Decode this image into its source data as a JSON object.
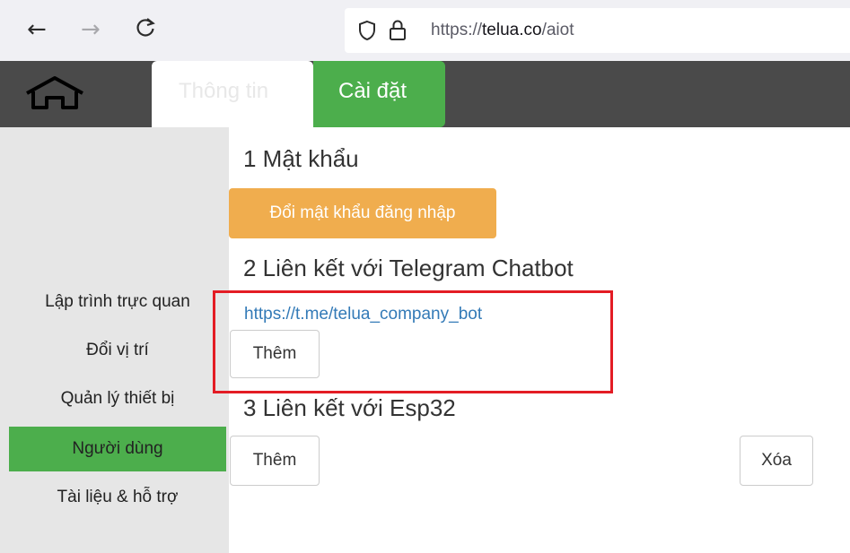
{
  "browser": {
    "back_icon": "←",
    "forward_icon": "→",
    "reload_icon": "C",
    "url_prefix": "https://",
    "url_domain": "telua.co",
    "url_path": "/aiot"
  },
  "header": {
    "tabs": [
      {
        "label": "Thông tin",
        "active": false
      },
      {
        "label": "Cài đặt",
        "active": true
      }
    ],
    "colors": {
      "bar": "#4a4a4a",
      "active_tab": "#4cae4c"
    }
  },
  "sidebar": {
    "items": [
      {
        "label": "Lập trình trực quan",
        "active": false
      },
      {
        "label": "Đổi vị trí",
        "active": false
      },
      {
        "label": "Quản lý thiết bị",
        "active": false
      },
      {
        "label": "Người dùng",
        "active": true
      },
      {
        "label": "Tài liệu & hỗ trợ",
        "active": false
      }
    ]
  },
  "main": {
    "section1": {
      "title": "1 Mật khẩu",
      "button": "Đổi mật khẩu đăng nhập"
    },
    "section2": {
      "title": "2 Liên kết với Telegram Chatbot",
      "link": "https://t.me/telua_company_bot",
      "add_button": "Thêm"
    },
    "section3": {
      "title": "3 Liên kết với Esp32",
      "add_button": "Thêm",
      "delete_button": "Xóa"
    }
  },
  "colors": {
    "green": "#4cae4c",
    "orange": "#f0ad4e",
    "link": "#337ab7",
    "highlight": "#e31c24"
  }
}
